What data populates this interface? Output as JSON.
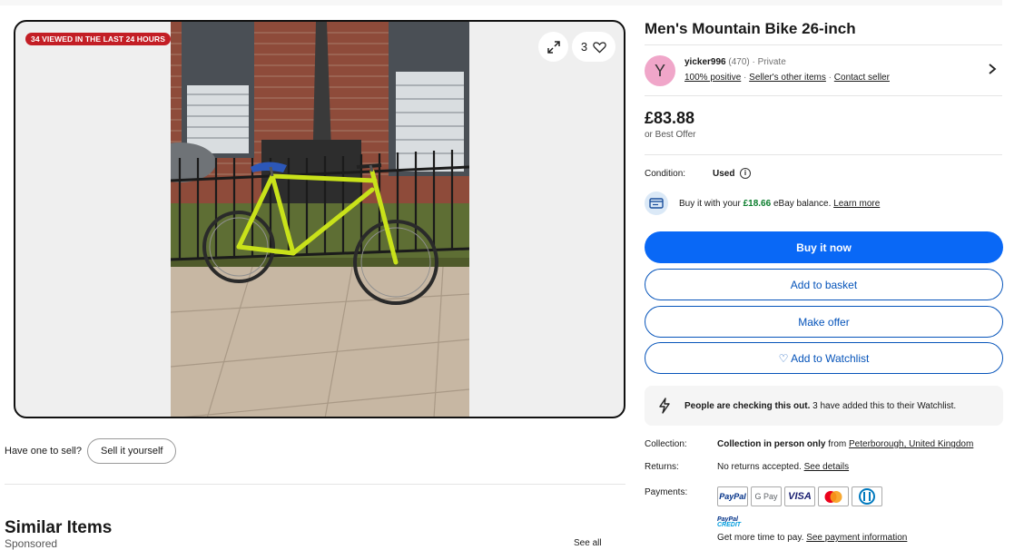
{
  "listing": {
    "viewed_badge": "34 VIEWED IN THE LAST 24 HOURS",
    "watch_count": "3",
    "title": "Men's Mountain Bike 26-inch"
  },
  "seller": {
    "avatar_letter": "Y",
    "name": "yicker996",
    "feedback_count": "(470)",
    "type": "· Private",
    "positive": "100% positive",
    "other_items": "Seller's other items",
    "contact": "Contact seller",
    "sep": "·"
  },
  "price": {
    "amount": "£83.88",
    "best_offer": "or Best Offer"
  },
  "condition": {
    "label": "Condition:",
    "value": "Used"
  },
  "balance": {
    "prefix": "Buy it with your",
    "amount": "£18.66",
    "suffix": "eBay balance.",
    "link": "Learn more"
  },
  "buttons": {
    "buy_now": "Buy it now",
    "add_basket": "Add to basket",
    "make_offer": "Make offer",
    "watchlist": "♡ Add to Watchlist"
  },
  "checking": {
    "bold": "People are checking this out.",
    "rest": "3 have added this to their Watchlist."
  },
  "collection": {
    "label": "Collection:",
    "bold": "Collection in person only",
    "from": "from",
    "location": "Peterborough, United Kingdom"
  },
  "returns": {
    "label": "Returns:",
    "text": "No returns accepted.",
    "link": "See details"
  },
  "payments": {
    "label": "Payments:",
    "methods": [
      "PayPal",
      "G Pay",
      "VISA",
      "Mastercard",
      "Diners"
    ],
    "credit_line1": "PayPal",
    "credit_line2": "CREDIT",
    "more_time": "Get more time to pay.",
    "more_time_link": "See payment information"
  },
  "sell": {
    "label": "Have one to sell?",
    "button": "Sell it yourself"
  },
  "similar": {
    "title": "Similar Items",
    "sponsored": "Sponsored",
    "see_all": "See all"
  },
  "colors": {
    "primary_button": "#0968f6",
    "link_blue": "#0654ba",
    "badge_red": "#c31e25",
    "balance_green": "#0a7d2c"
  }
}
